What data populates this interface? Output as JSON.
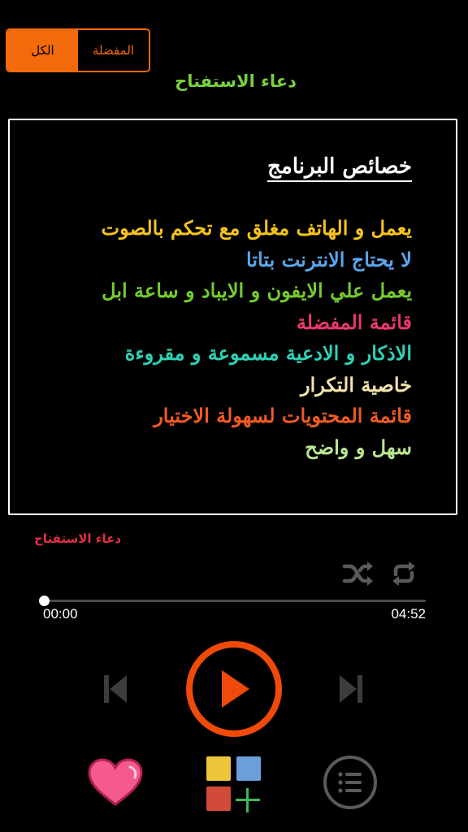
{
  "tabs": {
    "all_label": "الكل",
    "favorites_label": "المفضلة"
  },
  "page_title": "دعاء الاستفتاح",
  "info": {
    "heading": "خصائص البرنامج",
    "features": [
      {
        "text": "يعمل و الهاتف مغلق مع تحكم بالصوت",
        "color": "#f5c31c"
      },
      {
        "text": "لا يحتاج الانترنت بتاتا",
        "color": "#5aa7ec"
      },
      {
        "text": "يعمل علي الايفون و الايباد و ساعة ابل",
        "color": "#74cb2e"
      },
      {
        "text": "قائمة المفضلة",
        "color": "#e8386a"
      },
      {
        "text": "الاذكار و الادعية مسموعة و مقروءة",
        "color": "#2fd0b6"
      },
      {
        "text": "خاصية التكرار",
        "color": "#f3e4ae"
      },
      {
        "text": "قائمة المحتويات لسهولة الاختيار",
        "color": "#f05a22"
      },
      {
        "text": "سهل و واضح",
        "color": "#b8e68f"
      }
    ]
  },
  "player": {
    "track_title": "دعاء الاستفتاح",
    "elapsed": "00:00",
    "total": "04:52",
    "progress": 0.0
  },
  "icons": {
    "shuffle": "shuffle-icon",
    "repeat": "repeat-icon",
    "previous": "skip-previous-icon",
    "play": "play-icon",
    "next": "skip-next-icon",
    "favorite": "heart-icon",
    "add_playlist": "add-to-playlist-icon",
    "menu": "list-menu-icon"
  },
  "colors": {
    "accent": "#f26a0c",
    "play_ring": "#f04a0a",
    "title_green": "#78d03e",
    "track_red": "#e52d43",
    "heart_pink": "#f55a8c"
  }
}
